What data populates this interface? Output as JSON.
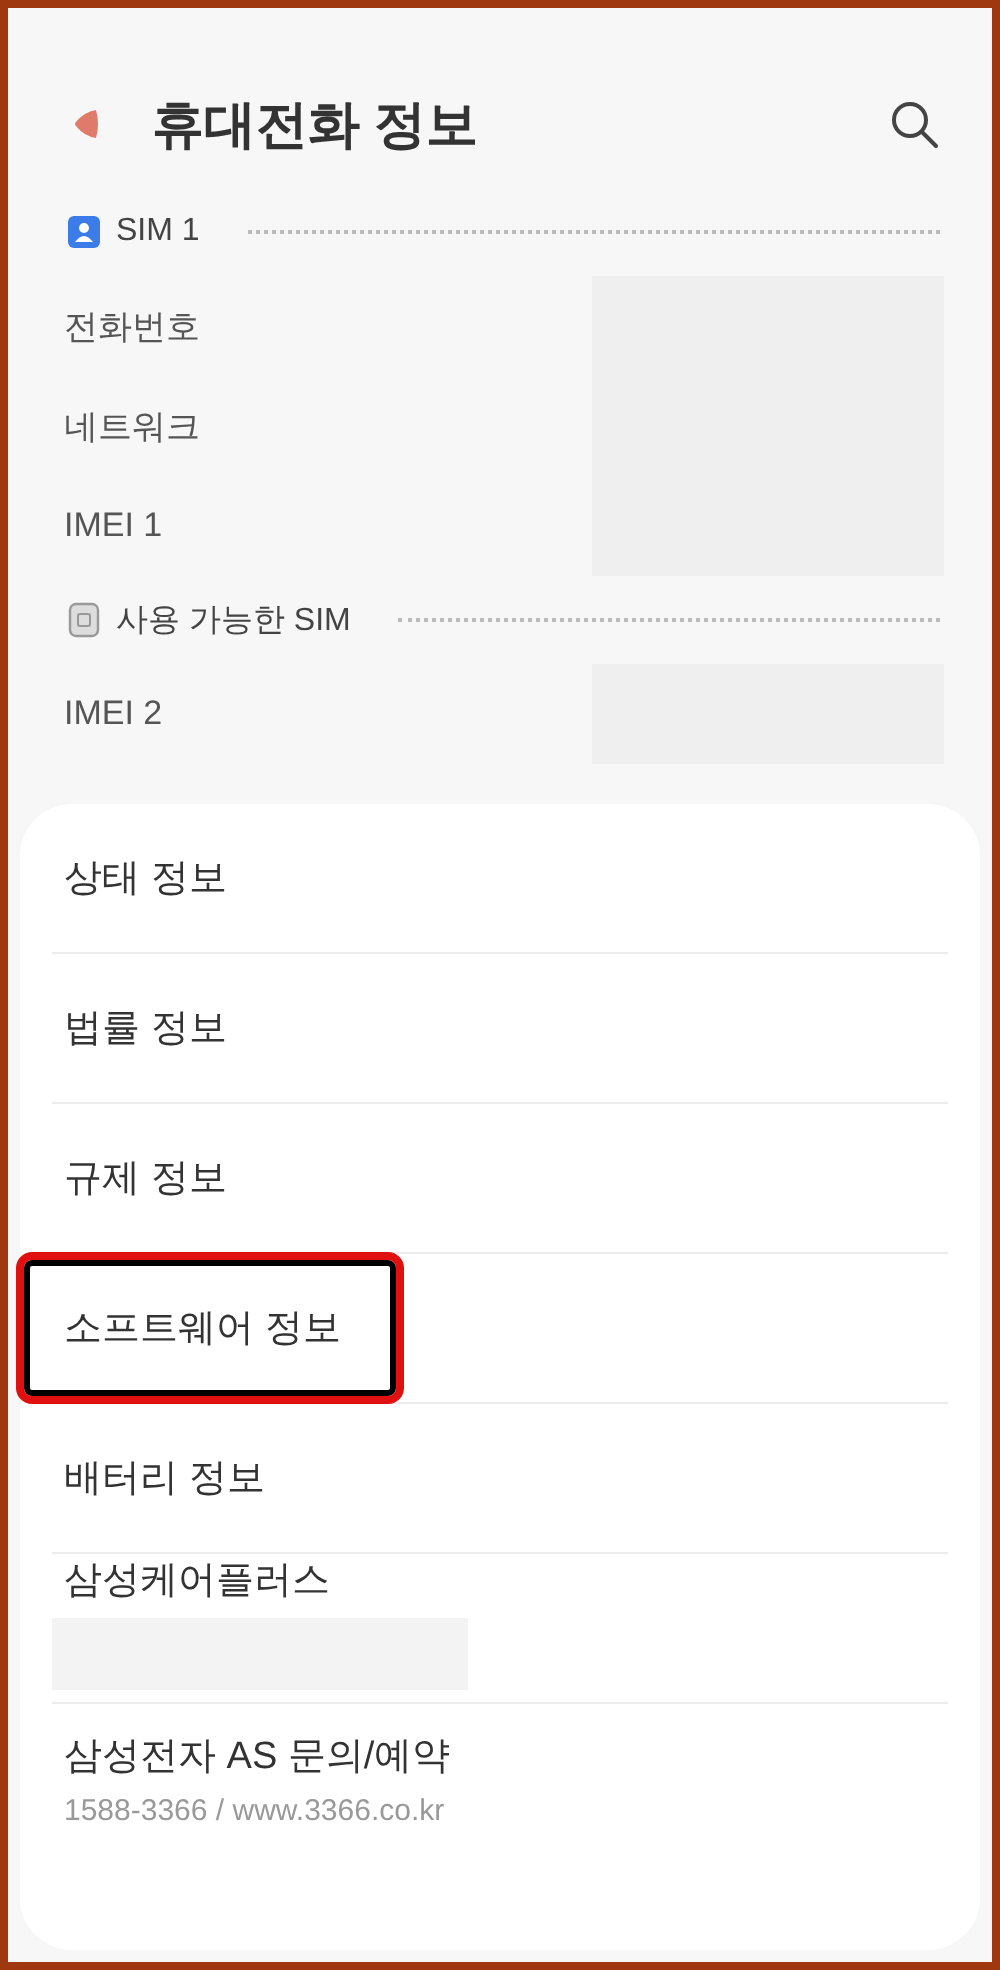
{
  "header": {
    "title": "휴대전화 정보"
  },
  "sims": [
    {
      "kind": "active",
      "label": "SIM 1",
      "rows": [
        {
          "label": "전화번호"
        },
        {
          "label": "네트워크"
        },
        {
          "label": "IMEI 1"
        }
      ]
    },
    {
      "kind": "empty",
      "label": "사용 가능한 SIM",
      "rows": [
        {
          "label": "IMEI 2"
        }
      ]
    }
  ],
  "menu": [
    {
      "label": "상태 정보",
      "highlighted": false
    },
    {
      "label": "법률 정보",
      "highlighted": false
    },
    {
      "label": "규제 정보",
      "highlighted": false
    },
    {
      "label": "소프트웨어 정보",
      "highlighted": true
    },
    {
      "label": "배터리 정보",
      "highlighted": false
    },
    {
      "label": "삼성케어플러스",
      "highlighted": false,
      "redacted": true
    },
    {
      "label": "삼성전자 AS 문의/예약",
      "highlighted": false,
      "subtitle": "1588-3366 / www.3366.co.kr"
    }
  ]
}
